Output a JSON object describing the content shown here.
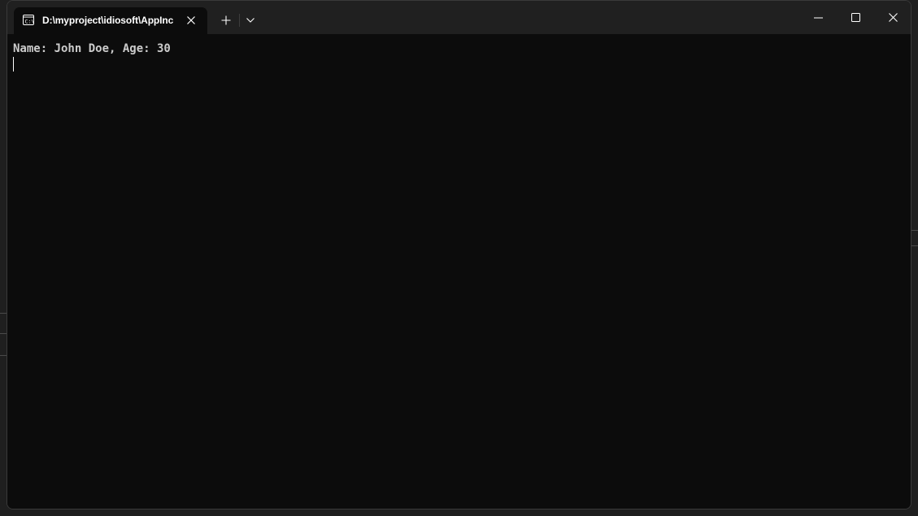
{
  "tab": {
    "title": "D:\\myproject\\idiosoft\\AppInc",
    "icon": "terminal-icon"
  },
  "toolbar": {
    "new_tab_icon": "plus-icon",
    "dropdown_icon": "chevron-down-icon"
  },
  "window_controls": {
    "minimize_icon": "minimize-icon",
    "maximize_icon": "maximize-icon",
    "close_icon": "close-icon"
  },
  "terminal": {
    "output_line": "Name: John Doe, Age: 30"
  },
  "colors": {
    "titlebar": "#202020",
    "terminal_bg": "#0c0c0c",
    "terminal_text": "#cccccc"
  }
}
